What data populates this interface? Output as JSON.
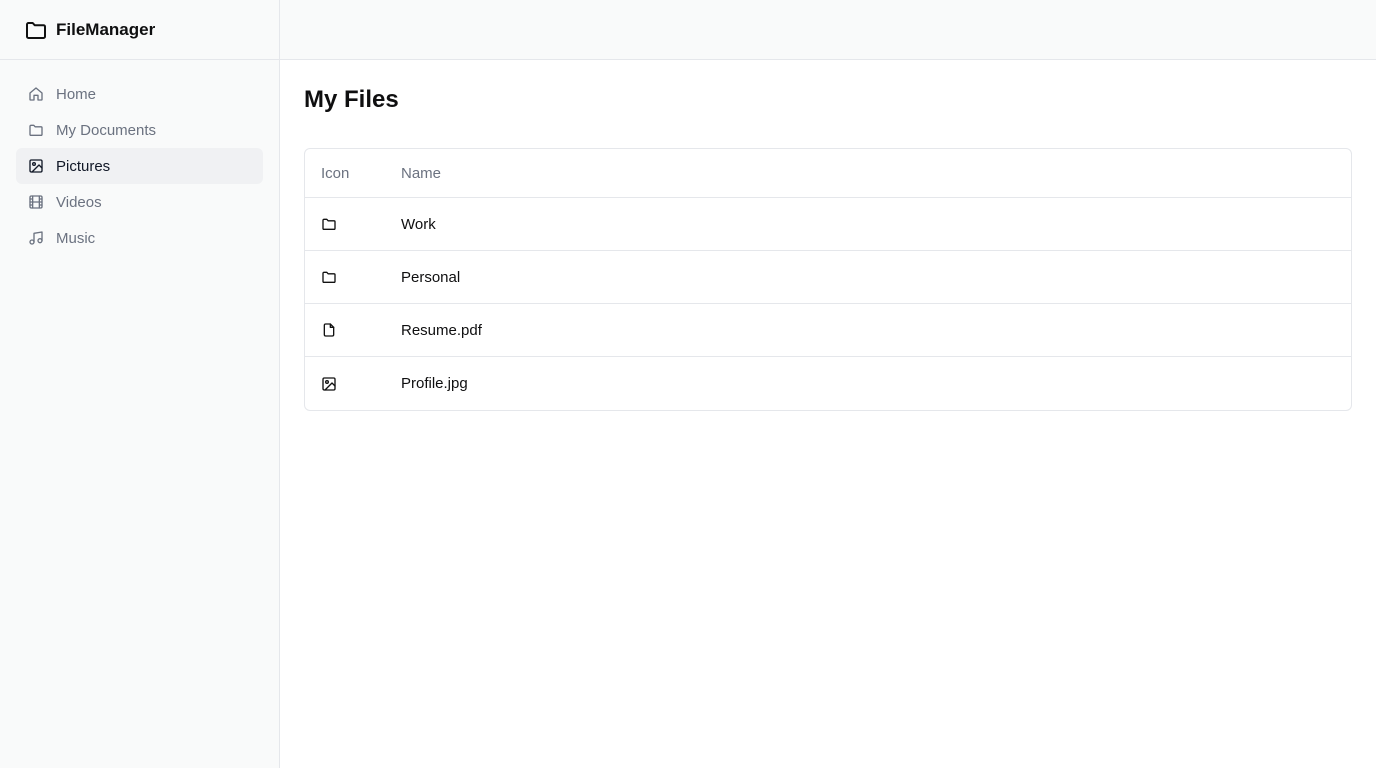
{
  "app": {
    "name": "FileManager",
    "logo_icon": "folder-icon"
  },
  "sidebar": {
    "items": [
      {
        "label": "Home",
        "icon": "home-icon",
        "active": false
      },
      {
        "label": "My Documents",
        "icon": "folder-icon",
        "active": false
      },
      {
        "label": "Pictures",
        "icon": "image-icon",
        "active": true
      },
      {
        "label": "Videos",
        "icon": "film-icon",
        "active": false
      },
      {
        "label": "Music",
        "icon": "music-note-icon",
        "active": false
      }
    ]
  },
  "main": {
    "title": "My Files",
    "table": {
      "headers": {
        "icon": "Icon",
        "name": "Name"
      },
      "rows": [
        {
          "icon": "folder-icon",
          "name": "Work"
        },
        {
          "icon": "folder-icon",
          "name": "Personal"
        },
        {
          "icon": "file-icon",
          "name": "Resume.pdf"
        },
        {
          "icon": "image-icon",
          "name": "Profile.jpg"
        }
      ]
    }
  },
  "colors": {
    "sidebar_bg": "#f9fafa",
    "active_item_bg": "#f0f1f3",
    "border": "#e5e7eb",
    "muted_text": "#6b7280",
    "text": "#0f0f10"
  }
}
